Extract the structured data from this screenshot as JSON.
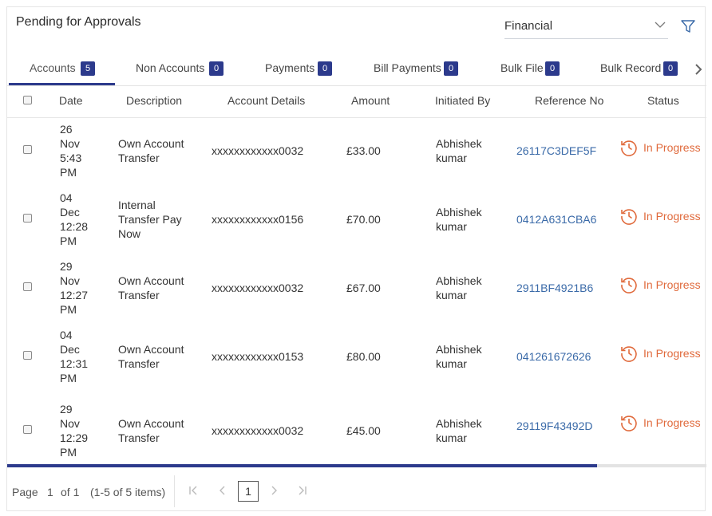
{
  "header": {
    "title": "Pending for Approvals",
    "category_select": {
      "value": "Financial"
    }
  },
  "tabs": [
    {
      "label": "Accounts",
      "count": "5"
    },
    {
      "label": "Non Accounts",
      "count": "0"
    },
    {
      "label": "Payments",
      "count": "0"
    },
    {
      "label": "Bill Payments",
      "count": "0"
    },
    {
      "label": "Bulk File",
      "count": "0"
    },
    {
      "label": "Bulk Record",
      "count": "0"
    }
  ],
  "table": {
    "columns": [
      "Date",
      "Description",
      "Account Details",
      "Amount",
      "Initiated By",
      "Reference No",
      "Status"
    ],
    "rows": [
      {
        "date": [
          "26",
          "Nov",
          "5:43",
          "PM"
        ],
        "description": [
          "Own Account",
          "Transfer"
        ],
        "account": "xxxxxxxxxxxx0032",
        "amount": "£33.00",
        "initiated_by": [
          "Abhishek",
          "kumar"
        ],
        "reference": "26117C3DEF5F",
        "status": "In Progress"
      },
      {
        "date": [
          "04",
          "Dec",
          "12:28",
          "PM"
        ],
        "description": [
          "Internal",
          "Transfer Pay",
          "Now"
        ],
        "account": "xxxxxxxxxxxx0156",
        "amount": "£70.00",
        "initiated_by": [
          "Abhishek",
          "kumar"
        ],
        "reference": "0412A631CBA6",
        "status": "In Progress"
      },
      {
        "date": [
          "29",
          "Nov",
          "12:27",
          "PM"
        ],
        "description": [
          "Own Account",
          "Transfer"
        ],
        "account": "xxxxxxxxxxxx0032",
        "amount": "£67.00",
        "initiated_by": [
          "Abhishek",
          "kumar"
        ],
        "reference": "2911BF4921B6",
        "status": "In Progress"
      },
      {
        "date": [
          "04",
          "Dec",
          "12:31",
          "PM"
        ],
        "description": [
          "Own Account",
          "Transfer"
        ],
        "account": "xxxxxxxxxxxx0153",
        "amount": "£80.00",
        "initiated_by": [
          "Abhishek",
          "kumar"
        ],
        "reference": "041261672626",
        "status": "In Progress"
      },
      {
        "date": [
          "29",
          "Nov",
          "12:29",
          "PM"
        ],
        "description": [
          "Own Account",
          "Transfer"
        ],
        "account": "xxxxxxxxxxxx0032",
        "amount": "£45.00",
        "initiated_by": [
          "Abhishek",
          "kumar"
        ],
        "reference": "29119F43492D",
        "status": "In Progress"
      }
    ]
  },
  "pagination": {
    "page_label": "Page",
    "page_value": "1",
    "of_label": "of 1",
    "items_label": "(1-5 of 5 items)",
    "current_page": "1"
  },
  "colors": {
    "accent": "#2c3a8c",
    "status": "#e06a3c",
    "link": "#3a6aa8"
  },
  "icons": [
    "chevron-down-icon",
    "filter-icon",
    "chevron-right-icon",
    "clock-history-icon",
    "first-page-icon",
    "prev-page-icon",
    "next-page-icon",
    "last-page-icon"
  ]
}
